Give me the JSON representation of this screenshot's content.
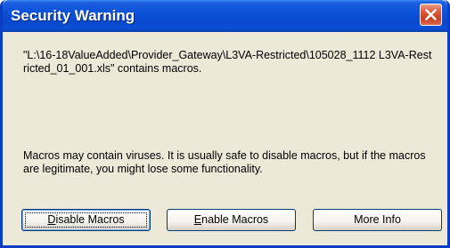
{
  "window": {
    "title": "Security Warning",
    "close_icon": "close-icon",
    "accent_color": "#0a52d8",
    "close_color": "#dd5a3c"
  },
  "message": {
    "text": "\"L:\\16-18ValueAdded\\Provider_Gateway\\L3VA-Restricted\\105028_1112 L3VA-Restricted_01_001.xls\" contains macros."
  },
  "warning": {
    "text": "Macros may contain viruses. It is usually safe to disable macros, but if the macros are legitimate, you might lose some functionality."
  },
  "buttons": {
    "disable": {
      "accel": "D",
      "rest": "isable Macros"
    },
    "enable": {
      "accel": "E",
      "rest": "nable Macros"
    },
    "more_info": {
      "accel": "",
      "rest": "More Info"
    }
  }
}
